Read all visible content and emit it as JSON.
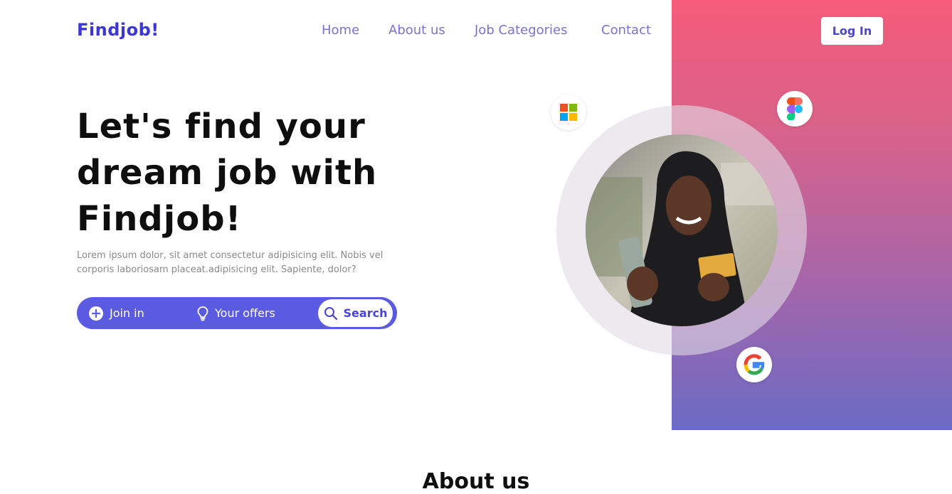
{
  "brand": {
    "name": "Findjob!",
    "accent": "#3c35d8"
  },
  "nav": {
    "items": [
      {
        "label": "Home"
      },
      {
        "label": "About us"
      },
      {
        "label": "Job Categories"
      },
      {
        "label": "Contact"
      }
    ],
    "login_label": "Log In"
  },
  "hero": {
    "title": "Let's find your dream job with Findjob!",
    "description": "Lorem ipsum dolor, sit amet consectetur adipisicing elit. Nobis vel corporis laboriosam placeat.adipisicing elit. Sapiente, dolor?",
    "actions": {
      "join_label": "Join in",
      "join_icon": "plus-circle-icon",
      "offers_label": "Your offers",
      "offers_icon": "lightbulb-icon",
      "search_label": "Search",
      "search_icon": "search-icon",
      "bar_color": "#5b5be2"
    }
  },
  "showcase": {
    "badges": [
      {
        "name": "microsoft-logo-icon"
      },
      {
        "name": "figma-logo-icon"
      },
      {
        "name": "google-logo-icon"
      }
    ],
    "gradient": [
      "#f65b7a",
      "#6a6bc5"
    ]
  },
  "about": {
    "heading": "About us"
  }
}
